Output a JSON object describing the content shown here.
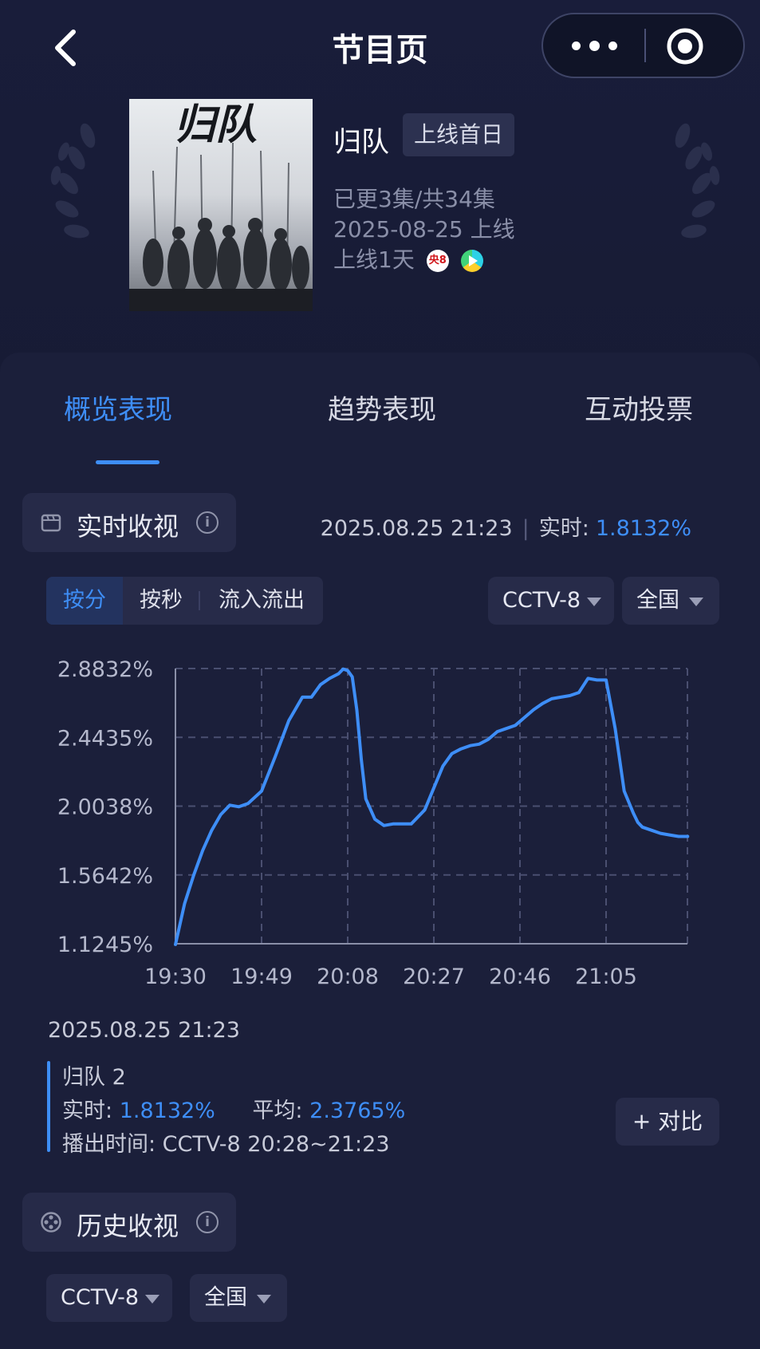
{
  "header": {
    "title": "节目页"
  },
  "show": {
    "title": "归队",
    "badge": "上线首日",
    "episodes": "已更3集/共34集",
    "launch_date": "2025-08-25 上线",
    "online_days": "上线1天",
    "poster_title": "归队",
    "channel_badge_text": "央8"
  },
  "tabs": [
    {
      "label": "概览表现",
      "active": true
    },
    {
      "label": "趋势表现",
      "active": false
    },
    {
      "label": "互动投票",
      "active": false
    }
  ],
  "realtime": {
    "section_title": "实时收视",
    "timestamp": "2025.08.25 21:23",
    "realtime_label": "实时:",
    "realtime_value": "1.8132%",
    "segments": [
      "按分",
      "按秒",
      "流入流出"
    ],
    "channel_select": "CCTV-8",
    "region_select": "全国",
    "legend": {
      "time": "2025.08.25 21:23",
      "episode": "归队 2",
      "realtime_label": "实时:",
      "realtime_value": "1.8132%",
      "average_label": "平均:",
      "average_value": "2.3765%",
      "airtime": "播出时间:  CCTV-8 20:28~21:23"
    },
    "compare_label": "+ 对比"
  },
  "history": {
    "section_title": "历史收视",
    "channel_select": "CCTV-8",
    "region_select": "全国"
  },
  "colors": {
    "accent": "#3e8ef7",
    "background": "#161a33",
    "card": "#1b1f3a"
  },
  "chart_data": {
    "type": "line",
    "y_tick_labels": [
      "2.8832%",
      "2.4435%",
      "2.0038%",
      "1.5642%",
      "1.1245%"
    ],
    "ylim": [
      1.1245,
      2.8832
    ],
    "x_tick_labels": [
      "19:30",
      "19:49",
      "20:08",
      "20:27",
      "20:46",
      "21:05"
    ],
    "grid": true,
    "x": [
      "19:30",
      "19:32",
      "19:34",
      "19:36",
      "19:38",
      "19:40",
      "19:42",
      "19:44",
      "19:46",
      "19:49",
      "19:52",
      "19:55",
      "19:58",
      "20:00",
      "20:02",
      "20:04",
      "20:06",
      "20:07",
      "20:08",
      "20:09",
      "20:10",
      "20:11",
      "20:12",
      "20:14",
      "20:16",
      "20:18",
      "20:20",
      "20:22",
      "20:25",
      "20:27",
      "20:29",
      "20:31",
      "20:33",
      "20:35",
      "20:37",
      "20:39",
      "20:41",
      "20:43",
      "20:45",
      "20:47",
      "20:49",
      "20:51",
      "20:53",
      "20:55",
      "20:57",
      "20:59",
      "21:01",
      "21:03",
      "21:05",
      "21:07",
      "21:09",
      "21:11",
      "21:12",
      "21:13",
      "21:15",
      "21:17",
      "21:19",
      "21:21",
      "21:23"
    ],
    "series": [
      {
        "values": [
          1.12,
          1.38,
          1.56,
          1.72,
          1.85,
          1.95,
          2.01,
          2.0,
          2.02,
          2.1,
          2.32,
          2.55,
          2.7,
          2.7,
          2.78,
          2.82,
          2.85,
          2.88,
          2.87,
          2.83,
          2.62,
          2.3,
          2.05,
          1.92,
          1.88,
          1.89,
          1.89,
          1.89,
          1.98,
          2.12,
          2.26,
          2.34,
          2.37,
          2.39,
          2.4,
          2.43,
          2.48,
          2.5,
          2.52,
          2.57,
          2.62,
          2.66,
          2.69,
          2.7,
          2.71,
          2.73,
          2.82,
          2.81,
          2.81,
          2.5,
          2.1,
          1.96,
          1.9,
          1.87,
          1.85,
          1.83,
          1.82,
          1.81,
          1.81
        ]
      }
    ]
  }
}
